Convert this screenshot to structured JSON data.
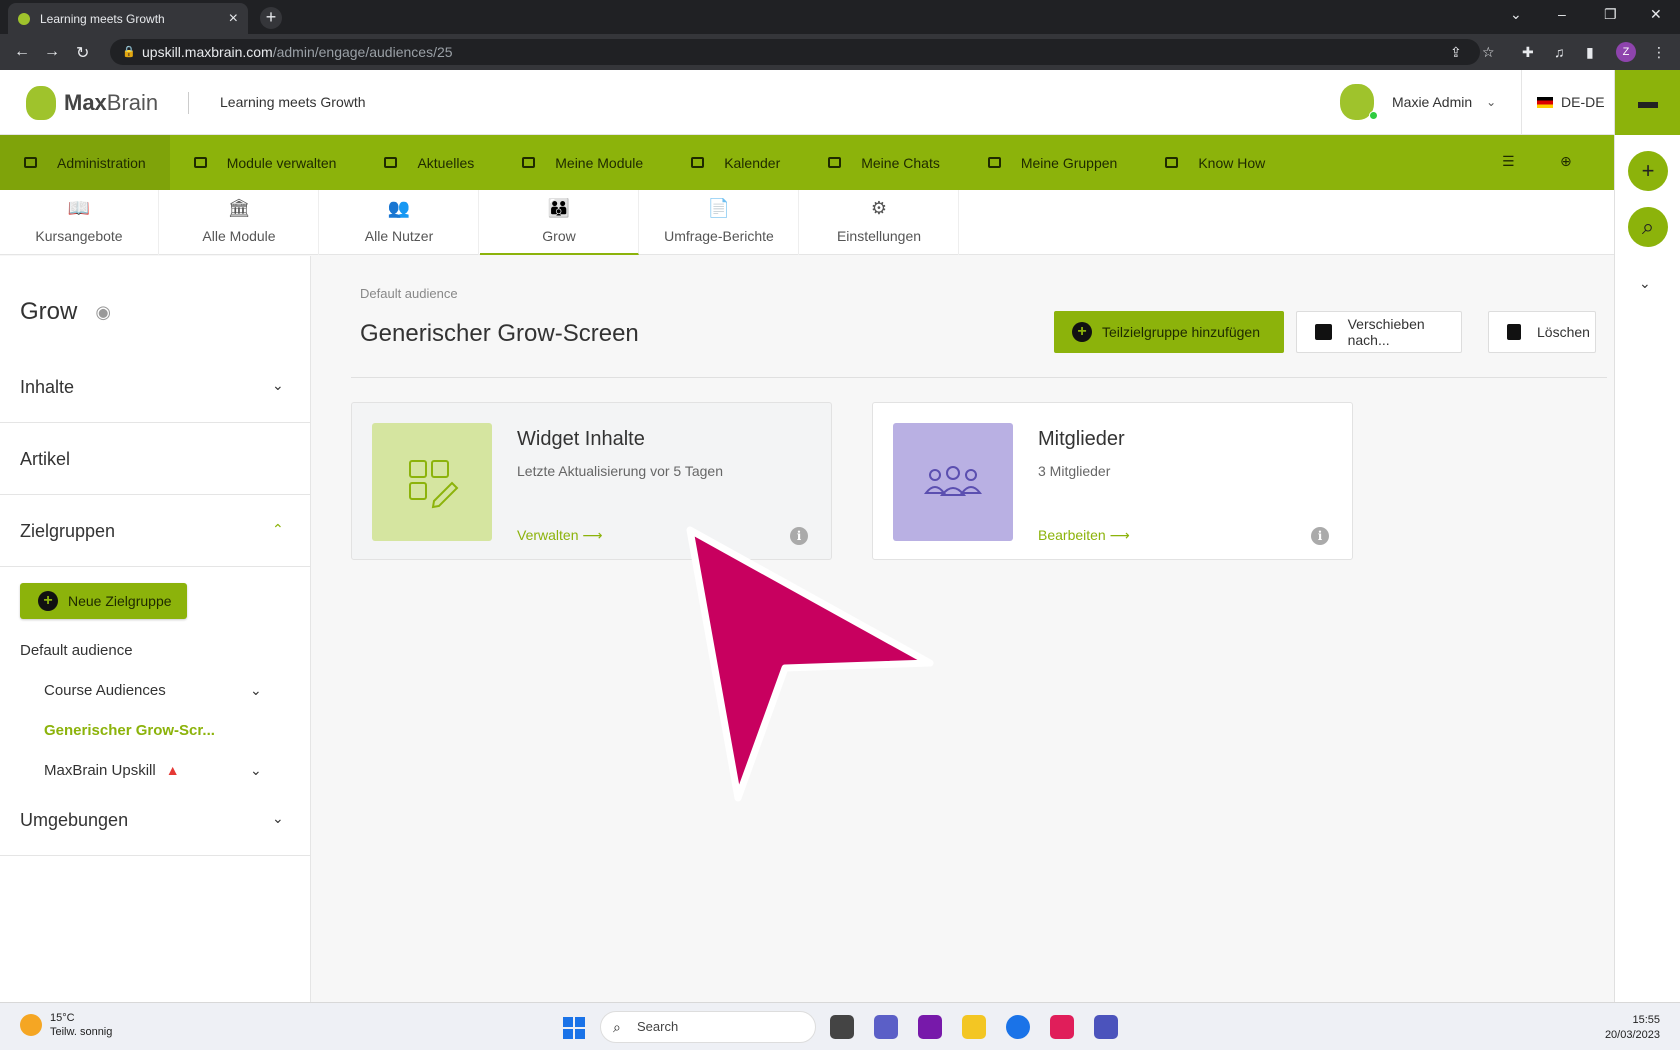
{
  "browser": {
    "tab_title": "Learning meets Growth",
    "url_host": "upskill.maxbrain.com",
    "url_path": "/admin/engage/audiences/25",
    "profile_initial": "Z"
  },
  "header": {
    "logo_bold": "Max",
    "logo_rest": "Brain",
    "tagline": "Learning meets Growth",
    "user_name": "Maxie Admin",
    "language": "DE-DE"
  },
  "nav": {
    "items": [
      {
        "label": "Administration",
        "active": true
      },
      {
        "label": "Module verwalten"
      },
      {
        "label": "Aktuelles"
      },
      {
        "label": "Meine Module"
      },
      {
        "label": "Kalender"
      },
      {
        "label": "Meine Chats"
      },
      {
        "label": "Meine Gruppen"
      },
      {
        "label": "Know How"
      }
    ]
  },
  "subtabs": [
    {
      "label": "Kursangebote",
      "icon": "hand-book-icon"
    },
    {
      "label": "Alle Module",
      "icon": "institution-icon"
    },
    {
      "label": "Alle Nutzer",
      "icon": "users-icon"
    },
    {
      "label": "Grow",
      "icon": "group-icon",
      "active": true
    },
    {
      "label": "Umfrage-Berichte",
      "icon": "report-icon"
    },
    {
      "label": "Einstellungen",
      "icon": "gears-icon"
    }
  ],
  "sidebar": {
    "title": "Grow",
    "sections": {
      "inhalte": "Inhalte",
      "artikel": "Artikel",
      "zielgruppen": "Zielgruppen",
      "umgebungen": "Umgebungen"
    },
    "new_group_label": "Neue Zielgruppe",
    "audience_root": "Default audience",
    "audiences": [
      {
        "label": "Course Audiences"
      },
      {
        "label": "Generischer Grow-Scr..."
      },
      {
        "label": "MaxBrain Upskill"
      }
    ]
  },
  "main": {
    "breadcrumb": "Default audience",
    "title": "Generischer Grow-Screen",
    "buttons": {
      "add_subgroup": "Teilzielgruppe hinzufügen",
      "move": "Verschieben nach...",
      "delete": "Löschen"
    },
    "cards": [
      {
        "title": "Widget Inhalte",
        "subtitle": "Letzte Aktualisierung vor 5 Tagen",
        "link": "Verwalten",
        "thumb_color": "#d5e5a0"
      },
      {
        "title": "Mitglieder",
        "subtitle": "3 Mitglieder",
        "link": "Bearbeiten",
        "thumb_color": "#b9b0e3"
      }
    ]
  },
  "taskbar": {
    "temperature": "15°C",
    "weather": "Teilw. sonnig",
    "search_label": "Search",
    "time": "15:55",
    "date": "20/03/2023"
  },
  "colors": {
    "brand_green": "#8cb30b",
    "cursor_magenta": "#c8005f"
  }
}
